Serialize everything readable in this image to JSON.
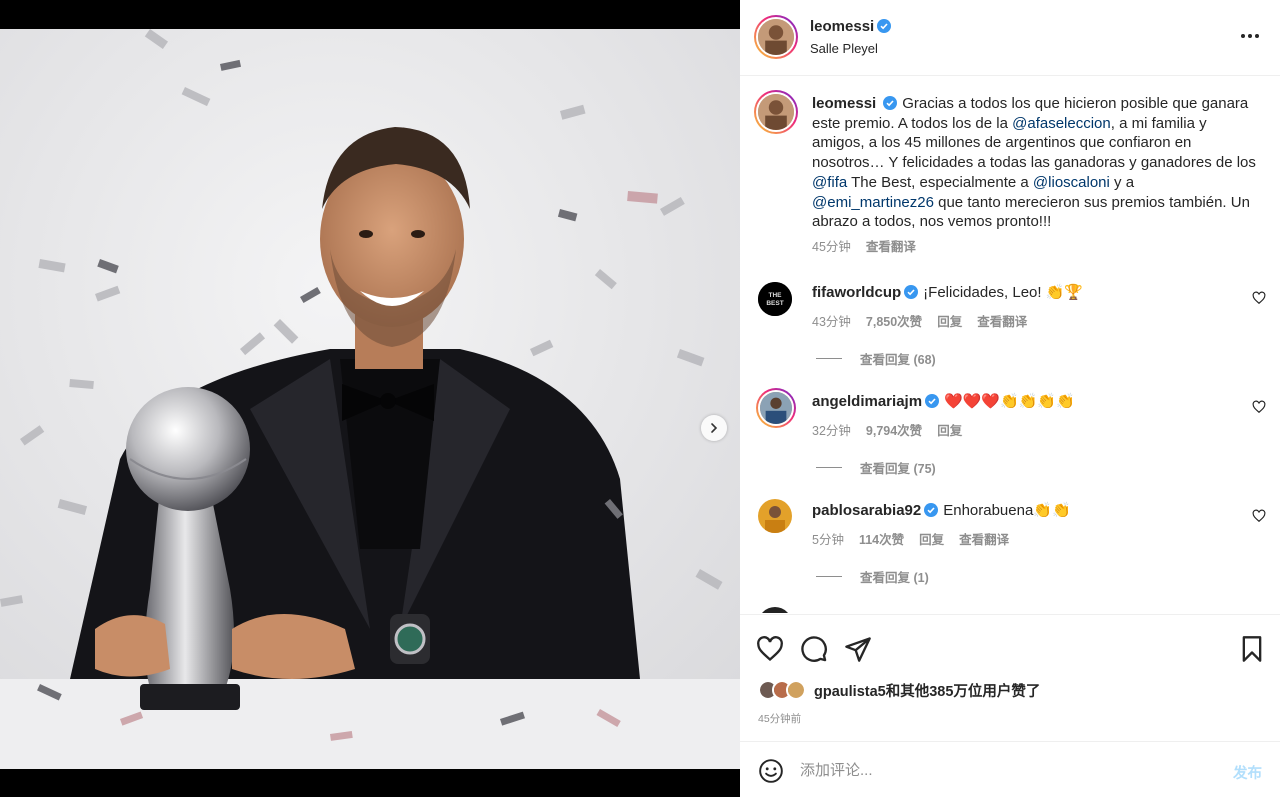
{
  "post": {
    "author": "leomessi",
    "location": "Salle Pleyel",
    "caption_parts": [
      {
        "text": "Gracias a todos los que hicieron posible que ganara este premio. A todos los de la ",
        "mention": false
      },
      {
        "text": "@afaseleccion",
        "mention": true
      },
      {
        "text": ", a mi familia y amigos, a los 45 millones de argentinos que confiaron en nosotros… Y felicidades a todas las ganadoras y ganadores de los ",
        "mention": false
      },
      {
        "text": "@fifa",
        "mention": true
      },
      {
        "text": " The Best, especialmente a ",
        "mention": false
      },
      {
        "text": "@lioscaloni",
        "mention": true
      },
      {
        "text": " y a ",
        "mention": false
      },
      {
        "text": "@emi_martinez26",
        "mention": true
      },
      {
        "text": " que tanto merecieron sus premios también. Un abrazo a todos, nos vemos pronto!!!",
        "mention": false
      }
    ],
    "caption_time": "45分钟",
    "caption_translate": "查看翻译",
    "likes_text": "gpaulista5和其他385万位用户赞了",
    "post_time": "45分钟前"
  },
  "comments": [
    {
      "user": "fifaworldcup",
      "text": "¡Felicidades, Leo! 👏🏆",
      "time": "43分钟",
      "likes": "7,850次赞",
      "reply": "回复",
      "translate": "查看翻译",
      "view_replies": "查看回复 (68)"
    },
    {
      "user": "angeldimariajm",
      "text": "❤️❤️❤️👏👏👏👏",
      "time": "32分钟",
      "likes": "9,794次赞",
      "reply": "回复",
      "translate": "",
      "view_replies": "查看回复 (75)"
    },
    {
      "user": "pablosarabia92",
      "text": "Enhorabuena👏👏",
      "time": "5分钟",
      "likes": "114次赞",
      "reply": "回复",
      "translate": "查看翻译",
      "view_replies": "查看回复 (1)"
    }
  ],
  "comment_box": {
    "placeholder": "添加评论...",
    "post_label": "发布"
  },
  "colors": {
    "verified": "#3897f0",
    "mention": "#00376b",
    "muted": "#8e8e8e",
    "post_disabled": "#b2dffc"
  },
  "icons": {
    "more": "more-horizontal-icon",
    "like": "heart-icon",
    "comment": "comment-icon",
    "share": "paper-plane-icon",
    "save": "bookmark-icon",
    "emoji": "smiley-icon",
    "next": "chevron-right-icon"
  }
}
